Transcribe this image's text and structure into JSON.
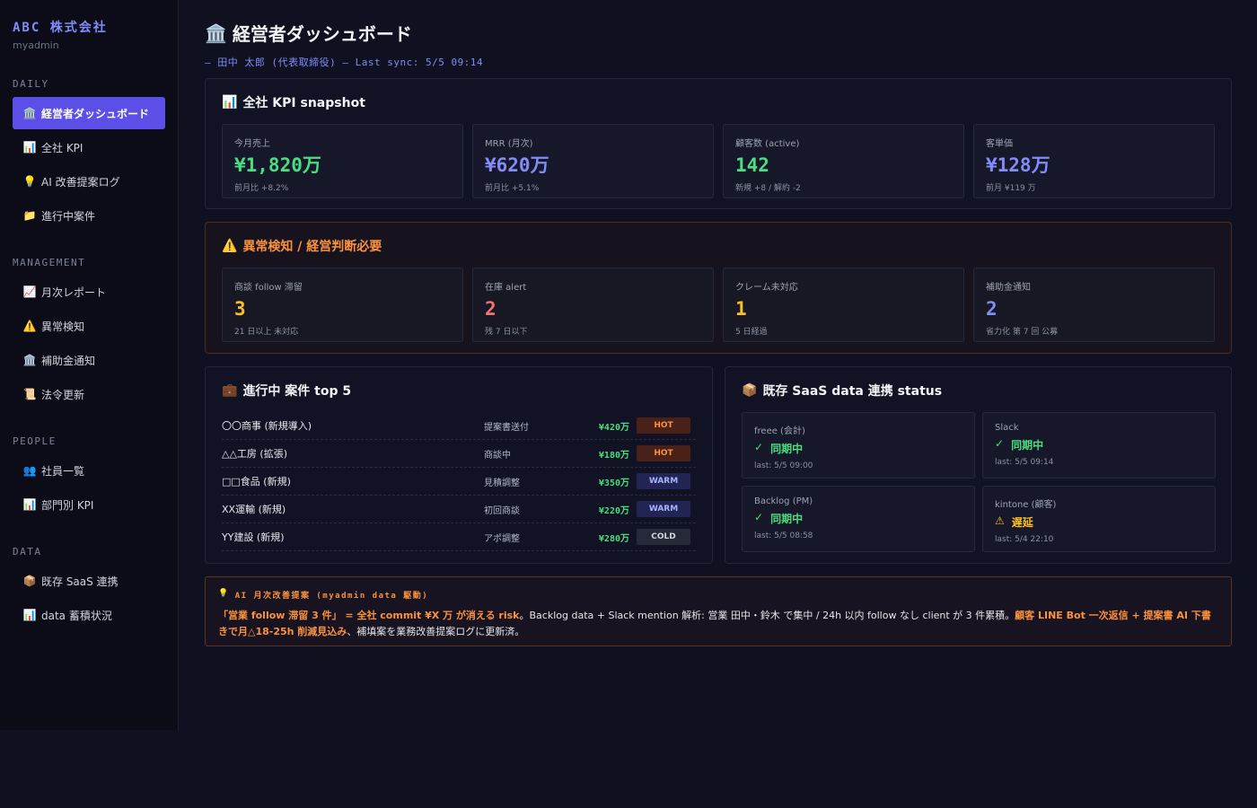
{
  "sidebar": {
    "brand": "ABC 株式会社",
    "brand_sub": "myadmin",
    "sections": [
      {
        "label": "DAILY",
        "items": [
          {
            "icon": "bank-icon",
            "glyph": "🏛️",
            "label": "経営者ダッシュボード",
            "active": true
          },
          {
            "icon": "bar-chart-icon",
            "glyph": "📊",
            "label": "全社 KPI"
          },
          {
            "icon": "lightbulb-icon",
            "glyph": "💡",
            "label": "AI 改善提案ログ"
          },
          {
            "icon": "folder-icon",
            "glyph": "📁",
            "label": "進行中案件"
          }
        ]
      },
      {
        "label": "MANAGEMENT",
        "items": [
          {
            "icon": "trend-chart-icon",
            "glyph": "📈",
            "label": "月次レポート"
          },
          {
            "icon": "warning-icon",
            "glyph": "⚠️",
            "label": "異常検知"
          },
          {
            "icon": "bank-icon",
            "glyph": "🏛️",
            "label": "補助金通知"
          },
          {
            "icon": "scroll-icon",
            "glyph": "📜",
            "label": "法令更新"
          }
        ]
      },
      {
        "label": "PEOPLE",
        "items": [
          {
            "icon": "people-icon",
            "glyph": "👥",
            "label": "社員一覧"
          },
          {
            "icon": "bar-chart-icon",
            "glyph": "📊",
            "label": "部門別 KPI"
          }
        ]
      },
      {
        "label": "DATA",
        "items": [
          {
            "icon": "package-icon",
            "glyph": "📦",
            "label": "既存 SaaS 連携"
          },
          {
            "icon": "bar-chart-icon",
            "glyph": "📊",
            "label": "data 蓄積状況"
          }
        ]
      }
    ]
  },
  "header": {
    "icon_glyph": "🏛️",
    "title": "経営者ダッシュボード",
    "subtitle": "— 田中 太郎 (代表取締役) — Last sync: 5/5 09:14"
  },
  "kpi": {
    "icon_glyph": "📊",
    "title": "全社 KPI snapshot",
    "cards": [
      {
        "label": "今月売上",
        "value": "¥1,820万",
        "note": "前月比 +8.2%",
        "color": "#4ade80"
      },
      {
        "label": "MRR (月次)",
        "value": "¥620万",
        "note": "前月比 +5.1%",
        "color": "#818cf8"
      },
      {
        "label": "顧客数 (active)",
        "value": "142",
        "note": "新規 +8 / 解約 -2",
        "color": "#4ade80"
      },
      {
        "label": "客単価",
        "value": "¥128万",
        "note": "前月 ¥119 万",
        "color": "#818cf8"
      }
    ]
  },
  "alerts": {
    "icon_glyph": "⚠️",
    "title": "異常検知 / 経営判断必要",
    "cards": [
      {
        "label": "商談 follow 滞留",
        "value": "3",
        "note": "21 日以上 未対応",
        "color": "#fbbf24"
      },
      {
        "label": "在庫 alert",
        "value": "2",
        "note": "残 7 日以下",
        "color": "#f87171"
      },
      {
        "label": "クレーム未対応",
        "value": "1",
        "note": "5 日経過",
        "color": "#fbbf24"
      },
      {
        "label": "補助金通知",
        "value": "2",
        "note": "省力化 第 7 回 公募",
        "color": "#818cf8"
      }
    ]
  },
  "deals": {
    "icon_glyph": "💼",
    "title": "進行中 案件 top 5",
    "rows": [
      {
        "name": "〇〇商事 (新規導入)",
        "stage": "提案書送付",
        "amount": "¥420万",
        "badge": "HOT",
        "tone": "hot"
      },
      {
        "name": "△△工房 (拡張)",
        "stage": "商談中",
        "amount": "¥180万",
        "badge": "HOT",
        "tone": "hot"
      },
      {
        "name": "□□食品 (新規)",
        "stage": "見積調整",
        "amount": "¥350万",
        "badge": "WARM",
        "tone": "warm"
      },
      {
        "name": "XX運輸 (新規)",
        "stage": "初回商談",
        "amount": "¥220万",
        "badge": "WARM",
        "tone": "warm"
      },
      {
        "name": "YY建設 (新規)",
        "stage": "アポ調整",
        "amount": "¥280万",
        "badge": "COLD",
        "tone": "cold"
      }
    ]
  },
  "saas": {
    "icon_glyph": "📦",
    "title": "既存 SaaS data 連携 status",
    "cards": [
      {
        "name": "freee (会計)",
        "mark": "✓",
        "status": "同期中",
        "last": "last: 5/5 09:00",
        "color": "#4ade80"
      },
      {
        "name": "Slack",
        "mark": "✓",
        "status": "同期中",
        "last": "last: 5/5 09:14",
        "color": "#4ade80"
      },
      {
        "name": "Backlog (PM)",
        "mark": "✓",
        "status": "同期中",
        "last": "last: 5/5 08:58",
        "color": "#4ade80"
      },
      {
        "name": "kintone (顧客)",
        "mark": "⚠",
        "status": "遅延",
        "last": "last: 5/4 22:10",
        "color": "#fbbf24"
      }
    ]
  },
  "ai": {
    "icon_glyph": "💡",
    "label": "AI 月次改善提案 (myadmin data 駆動)",
    "hl1": "「営業 follow 滞留 3 件」 = 全社 commit ¥X 万 が消える risk",
    "text1": "。Backlog data + Slack mention 解析: 営業 田中・鈴木 で集中 / 24h 以内 follow なし client が 3 件累積。",
    "hl2": "顧客 LINE Bot 一次返信 + 提案書 AI 下書きで月△18-25h 削減見込み",
    "text2": "、補填案を業務改善提案ログに更新済。"
  }
}
